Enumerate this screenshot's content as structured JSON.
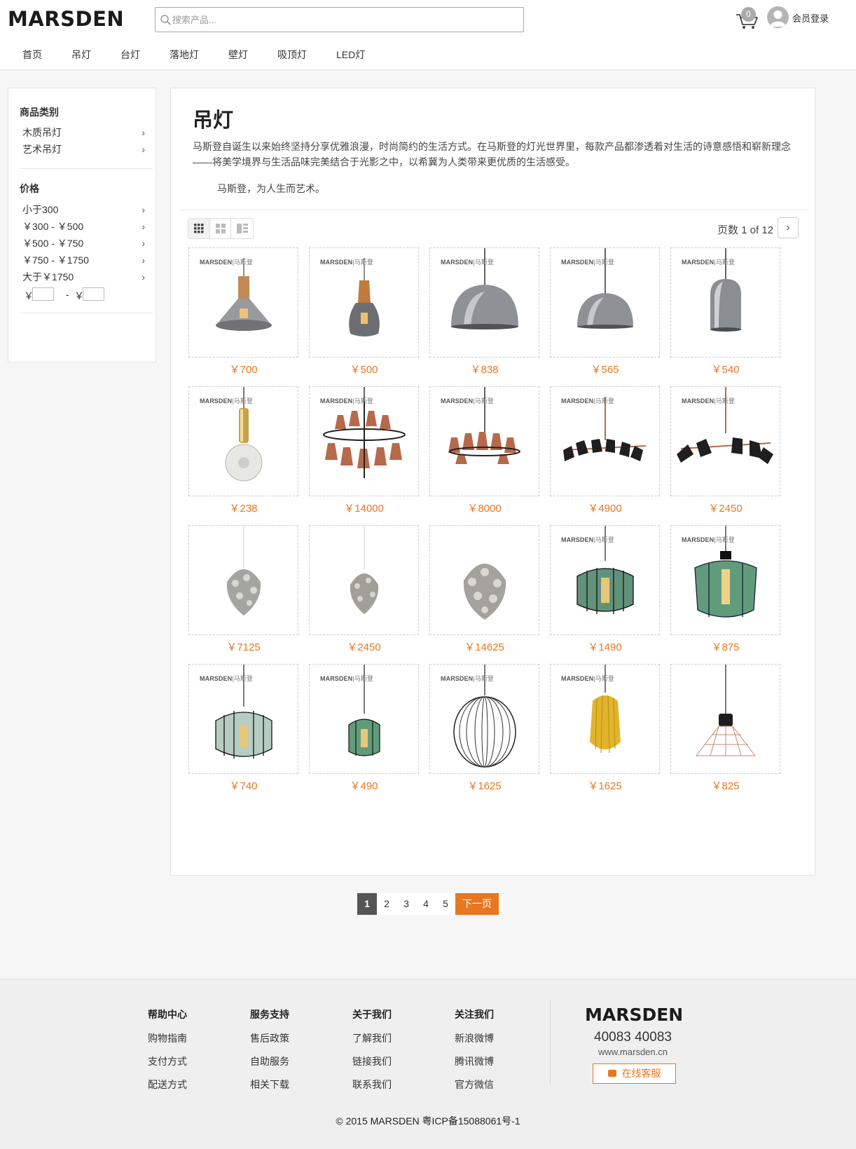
{
  "header": {
    "logo": "MARSDEN",
    "search_placeholder": "搜索产品...",
    "cart_count": "0",
    "login_label": "会员登录"
  },
  "nav": [
    "首页",
    "吊灯",
    "台灯",
    "落地灯",
    "壁灯",
    "吸顶灯",
    "LED灯"
  ],
  "sidebar": {
    "category_heading": "商品类别",
    "categories": [
      "木质吊灯",
      "艺术吊灯"
    ],
    "price_heading": "价格",
    "prices": [
      "小于300",
      "￥300 - ￥500",
      "￥500 - ￥750",
      "￥750 - ￥1750",
      "大于￥1750"
    ],
    "custom_currency": "￥",
    "custom_dash": "-"
  },
  "main": {
    "title": "吊灯",
    "intro": "马斯登自诞生以来始终坚持分享优雅浪漫，时尚简约的生活方式。在马斯登的灯光世界里，每款产品都渗透着对生活的诗意感悟和崭新理念——将美学境界与生活品味完美结合于光影之中，以希冀为人类带来更优质的生活感受。",
    "slogan": "马斯登，为人生而艺术。",
    "page_info": "页数 1 of 12"
  },
  "products": [
    {
      "price": "￥700",
      "brand": true,
      "type": "wood-cone"
    },
    {
      "price": "￥500",
      "brand": true,
      "type": "wood-bottle"
    },
    {
      "price": "￥838",
      "brand": true,
      "type": "chrome-dome"
    },
    {
      "price": "￥565",
      "brand": true,
      "type": "chrome-dome-small"
    },
    {
      "price": "￥540",
      "brand": true,
      "type": "chrome-bell"
    },
    {
      "price": "￥238",
      "brand": true,
      "type": "gold-bulb"
    },
    {
      "price": "￥14000",
      "brand": true,
      "type": "copper-tier2"
    },
    {
      "price": "￥8000",
      "brand": true,
      "type": "copper-tier1"
    },
    {
      "price": "￥4900",
      "brand": true,
      "type": "black-spider"
    },
    {
      "price": "￥2450",
      "brand": true,
      "type": "black-spider-large"
    },
    {
      "price": "￥7125",
      "brand": false,
      "type": "silver-cone"
    },
    {
      "price": "￥2450",
      "brand": false,
      "type": "silver-cone-small"
    },
    {
      "price": "￥14625",
      "brand": false,
      "type": "silver-cone-large"
    },
    {
      "price": "￥1490",
      "brand": true,
      "type": "green-cage"
    },
    {
      "price": "￥875",
      "brand": true,
      "type": "green-cage-tall"
    },
    {
      "price": "￥740",
      "brand": true,
      "type": "green-cage-wide"
    },
    {
      "price": "￥490",
      "brand": true,
      "type": "green-cage-small"
    },
    {
      "price": "￥1625",
      "brand": true,
      "type": "black-cage"
    },
    {
      "price": "￥1625",
      "brand": true,
      "type": "yellow-cage"
    },
    {
      "price": "￥825",
      "brand": false,
      "type": "copper-wire"
    }
  ],
  "brand_mark": {
    "name": "MARSDEN",
    "cn": "|马斯登"
  },
  "pagination": {
    "pages": [
      "1",
      "2",
      "3",
      "4",
      "5"
    ],
    "next": "下一页"
  },
  "footer": {
    "columns": [
      {
        "heading": "帮助中心",
        "links": [
          "购物指南",
          "支付方式",
          "配送方式"
        ]
      },
      {
        "heading": "服务支持",
        "links": [
          "售后政策",
          "自助服务",
          "相关下载"
        ]
      },
      {
        "heading": "关于我们",
        "links": [
          "了解我们",
          "链接我们",
          "联系我们"
        ]
      },
      {
        "heading": "关注我们",
        "links": [
          "新浪微博",
          "腾讯微博",
          "官方微信"
        ]
      }
    ],
    "logo": "MARSDEN",
    "phone": "40083 40083",
    "site": "www.marsden.cn",
    "chat": "在线客服",
    "copyright": "© 2015 MARSDEN  粤ICP备15088061号-1"
  },
  "colors": {
    "accent": "#e87722",
    "pager_current": "#555555"
  }
}
